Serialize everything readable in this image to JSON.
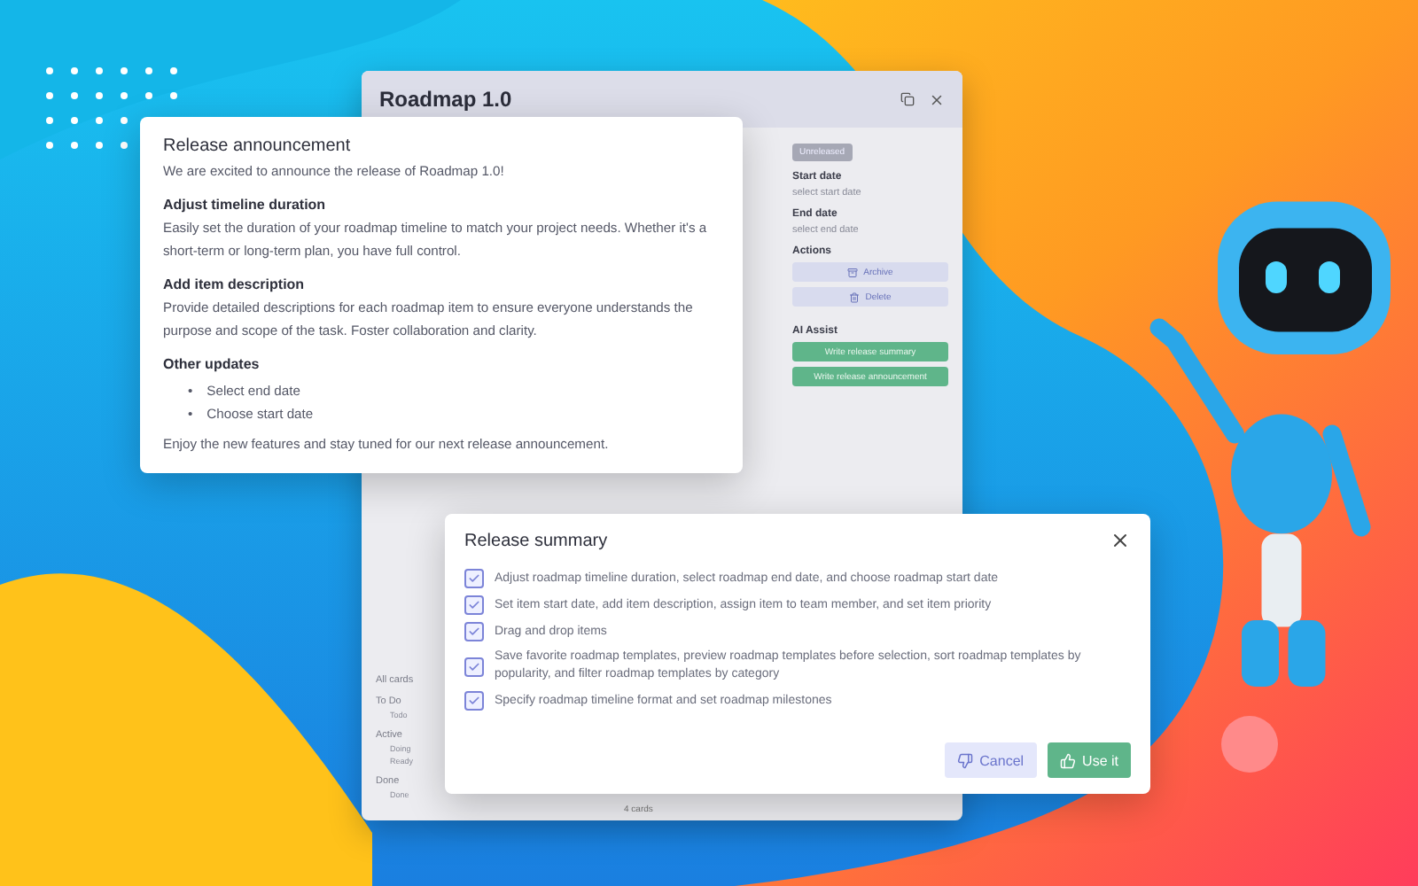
{
  "roadmap_window": {
    "title": "Roadmap 1.0",
    "status": "Unreleased",
    "fields": [
      {
        "label": "Start date",
        "value": "select start date"
      },
      {
        "label": "End date",
        "value": "select end date"
      }
    ],
    "actions_heading": "Actions",
    "actions": [
      {
        "kind": "archive",
        "label": "Archive"
      },
      {
        "kind": "delete",
        "label": "Delete"
      }
    ],
    "ai_heading": "AI Assist",
    "ai_buttons": [
      "Write release summary",
      "Write release announcement"
    ],
    "filters": [
      {
        "label": "All cards"
      },
      {
        "label": "To Do",
        "children": [
          {
            "label": "Todo"
          }
        ]
      },
      {
        "label": "Active",
        "children": [
          {
            "label": "Doing"
          },
          {
            "label": "Ready"
          }
        ]
      },
      {
        "label": "Done",
        "children": [
          {
            "label": "Done"
          }
        ]
      }
    ],
    "footer": "4 cards"
  },
  "announcement": {
    "title": "Release announcement",
    "intro": "We are excited to announce the release of Roadmap 1.0!",
    "sections": [
      {
        "heading": "Adjust timeline duration",
        "body": "Easily set the duration of your roadmap timeline to match your project needs. Whether it's a short-term or long-term plan, you have full control."
      },
      {
        "heading": "Add item description",
        "body": "Provide detailed descriptions for each roadmap item to ensure everyone understands the purpose and scope of the task. Foster collaboration and clarity."
      }
    ],
    "list_heading": "Other updates",
    "bullets": [
      {
        "marker": "•",
        "text": "Select end date"
      },
      {
        "marker": "•",
        "text": "Choose start date"
      }
    ],
    "outro": "Enjoy the new features and stay tuned for our next release announcement."
  },
  "summary": {
    "title": "Release summary",
    "items": [
      {
        "text": "Adjust roadmap timeline duration, select roadmap end date, and choose roadmap start date",
        "checked": true
      },
      {
        "text": "Set item start date, add item description, assign item to team member, and set item priority",
        "checked": true
      },
      {
        "text": "Drag and drop items",
        "checked": true
      },
      {
        "text": "Save favorite roadmap templates, preview roadmap templates before selection, sort roadmap templates by popularity, and filter roadmap templates by category",
        "checked": true
      },
      {
        "text": "Specify roadmap timeline format and set roadmap milestones",
        "checked": true
      }
    ],
    "cancel": "Cancel",
    "confirm": "Use it"
  }
}
